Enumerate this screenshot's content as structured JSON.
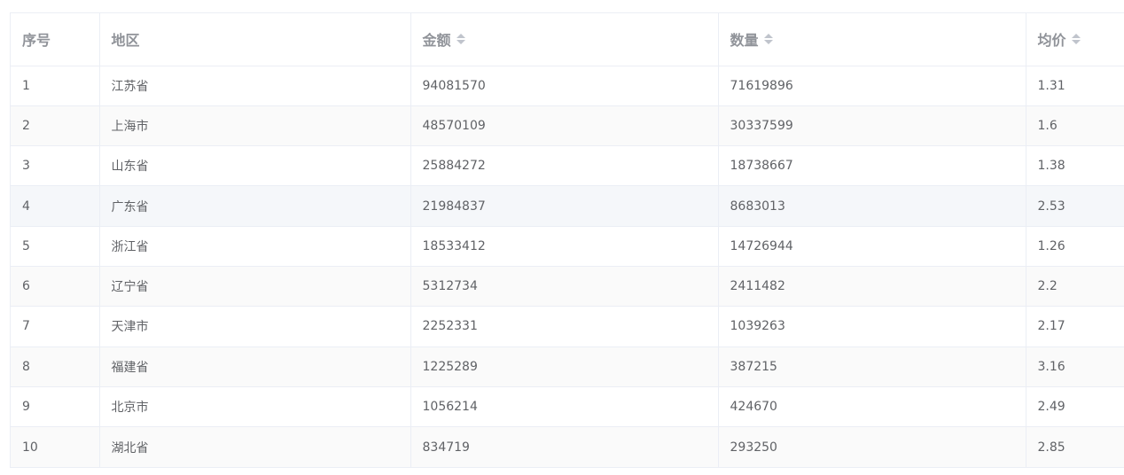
{
  "table": {
    "columns": [
      {
        "label": "序号",
        "sortable": false
      },
      {
        "label": "地区",
        "sortable": false
      },
      {
        "label": "金额",
        "sortable": true
      },
      {
        "label": "数量",
        "sortable": true
      },
      {
        "label": "均价",
        "sortable": true
      }
    ],
    "rows": [
      [
        "1",
        "江苏省",
        "94081570",
        "71619896",
        "1.31"
      ],
      [
        "2",
        "上海市",
        "48570109",
        "30337599",
        "1.6"
      ],
      [
        "3",
        "山东省",
        "25884272",
        "18738667",
        "1.38"
      ],
      [
        "4",
        "广东省",
        "21984837",
        "8683013",
        "2.53"
      ],
      [
        "5",
        "浙江省",
        "18533412",
        "14726944",
        "1.26"
      ],
      [
        "6",
        "辽宁省",
        "5312734",
        "2411482",
        "2.2"
      ],
      [
        "7",
        "天津市",
        "2252331",
        "1039263",
        "2.17"
      ],
      [
        "8",
        "福建省",
        "1225289",
        "387215",
        "3.16"
      ],
      [
        "9",
        "北京市",
        "1056214",
        "424670",
        "2.49"
      ],
      [
        "10",
        "湖北省",
        "834719",
        "293250",
        "2.85"
      ]
    ]
  },
  "colors": {
    "header_text": "#909399",
    "cell_text": "#606266",
    "border": "#ebeef5",
    "stripe_bg": "#fafafa",
    "hover_bg": "#f5f7fa",
    "sort_icon": "#c0c4cc"
  },
  "icons": {
    "sort": "sort-caret-icon"
  }
}
